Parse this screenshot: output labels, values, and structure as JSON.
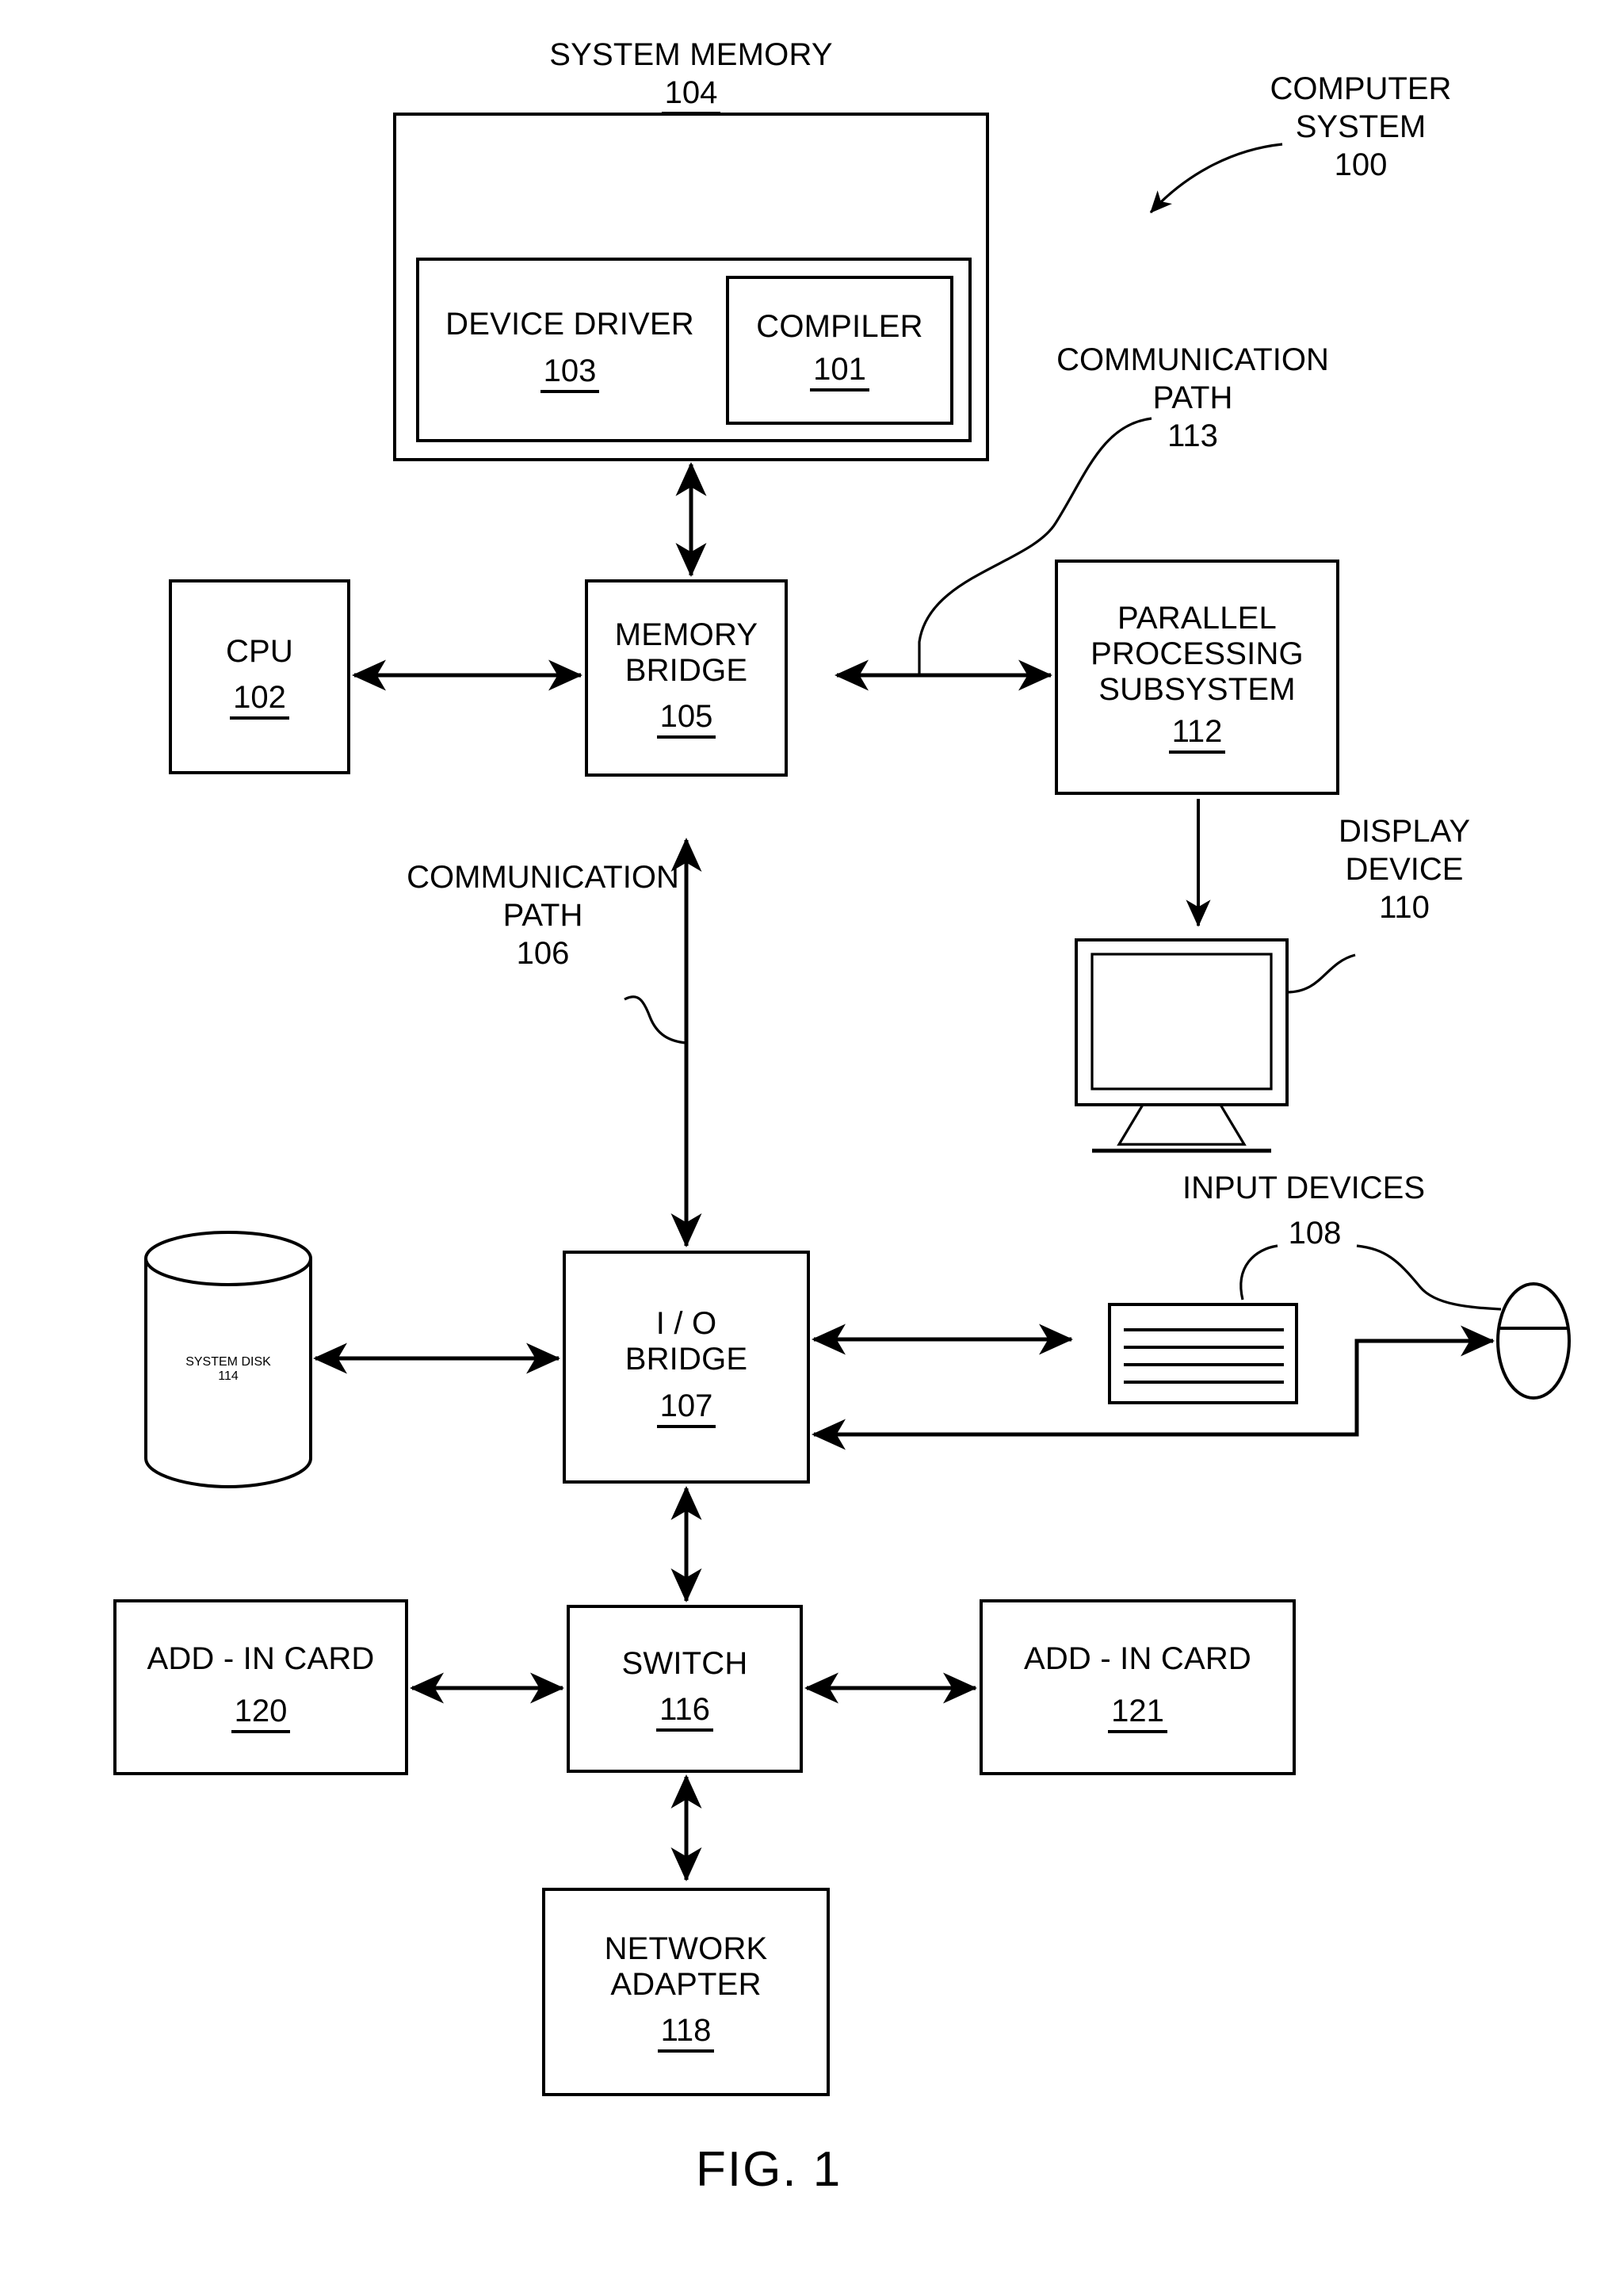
{
  "figure": {
    "caption": "FIG. 1",
    "callout_computer_system": "COMPUTER\nSYSTEM\n100"
  },
  "blocks": {
    "system_memory": {
      "title": "SYSTEM MEMORY",
      "num": "104"
    },
    "device_driver": {
      "title": "DEVICE DRIVER",
      "num": "103"
    },
    "compiler": {
      "title": "COMPILER",
      "num": "101"
    },
    "cpu": {
      "title": "CPU",
      "num": "102"
    },
    "memory_bridge": {
      "title": "MEMORY\nBRIDGE",
      "num": "105"
    },
    "parallel_processing_subsystem": {
      "title": "PARALLEL\nPROCESSING\nSUBSYSTEM",
      "num": "112"
    },
    "system_disk": {
      "title": "SYSTEM\nDISK",
      "num": "114"
    },
    "io_bridge": {
      "title": "I / O\nBRIDGE",
      "num": "107"
    },
    "switch": {
      "title": "SWITCH",
      "num": "116"
    },
    "add_in_card_left": {
      "title": "ADD - IN CARD",
      "num": "120"
    },
    "add_in_card_right": {
      "title": "ADD - IN CARD",
      "num": "121"
    },
    "network_adapter": {
      "title": "NETWORK\nADAPTER",
      "num": "118"
    }
  },
  "callouts": {
    "communication_path_113": "COMMUNICATION\nPATH\n113",
    "communication_path_106": "COMMUNICATION\nPATH\n106",
    "display_device_110": "DISPLAY\nDEVICE\n110",
    "input_devices_108": "INPUT  DEVICES",
    "input_devices_num": "108"
  },
  "icons": {
    "display": "monitor-icon",
    "keyboard": "keyboard-icon",
    "mouse": "mouse-icon",
    "disk": "cylinder-disk-icon"
  },
  "style": {
    "ink": "#000000",
    "paper": "#ffffff"
  }
}
